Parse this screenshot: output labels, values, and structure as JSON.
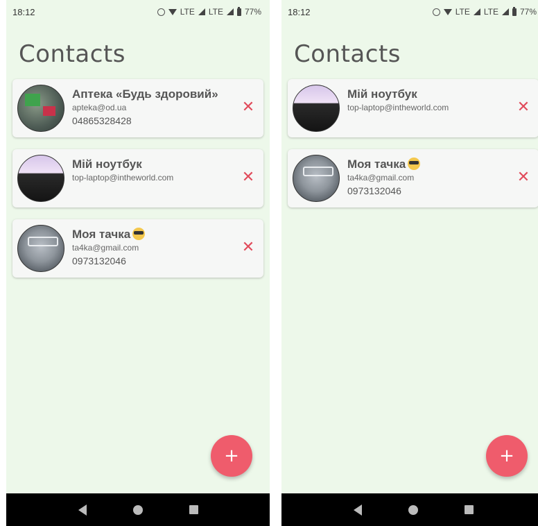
{
  "screens": [
    {
      "status": {
        "time": "18:12",
        "network": "LTE",
        "network2": "LTE",
        "battery": "77%"
      },
      "title": "Contacts",
      "contacts": [
        {
          "name": "Аптека «Будь здоровий»",
          "email": "apteka@od.ua",
          "phone": "04865328428",
          "avatar": "pharmacy-photo",
          "delete_icon": "✕"
        },
        {
          "name": "Мій ноутбук",
          "email": "top-laptop@intheworld.com",
          "phone": "",
          "avatar": "laptop-photo",
          "delete_icon": "✕"
        },
        {
          "name": "Моя тачка",
          "email": "ta4ka@gmail.com",
          "phone": "0973132046",
          "avatar": "car-photo",
          "delete_icon": "✕"
        }
      ],
      "fab_label": "+"
    },
    {
      "status": {
        "time": "18:12",
        "network": "LTE",
        "network2": "LTE",
        "battery": "77%"
      },
      "title": "Contacts",
      "contacts": [
        {
          "name": "Мій ноутбук",
          "email": "top-laptop@intheworld.com",
          "phone": "",
          "avatar": "laptop-photo",
          "delete_icon": "✕"
        },
        {
          "name": "Моя тачка",
          "email": "ta4ka@gmail.com",
          "phone": "0973132046",
          "avatar": "car-photo",
          "delete_icon": "✕"
        }
      ],
      "fab_label": "+"
    }
  ],
  "colors": {
    "background": "#edf8ea",
    "card": "#f6f7f6",
    "accent": "#ef5c6c",
    "delete": "#e14b5b"
  }
}
